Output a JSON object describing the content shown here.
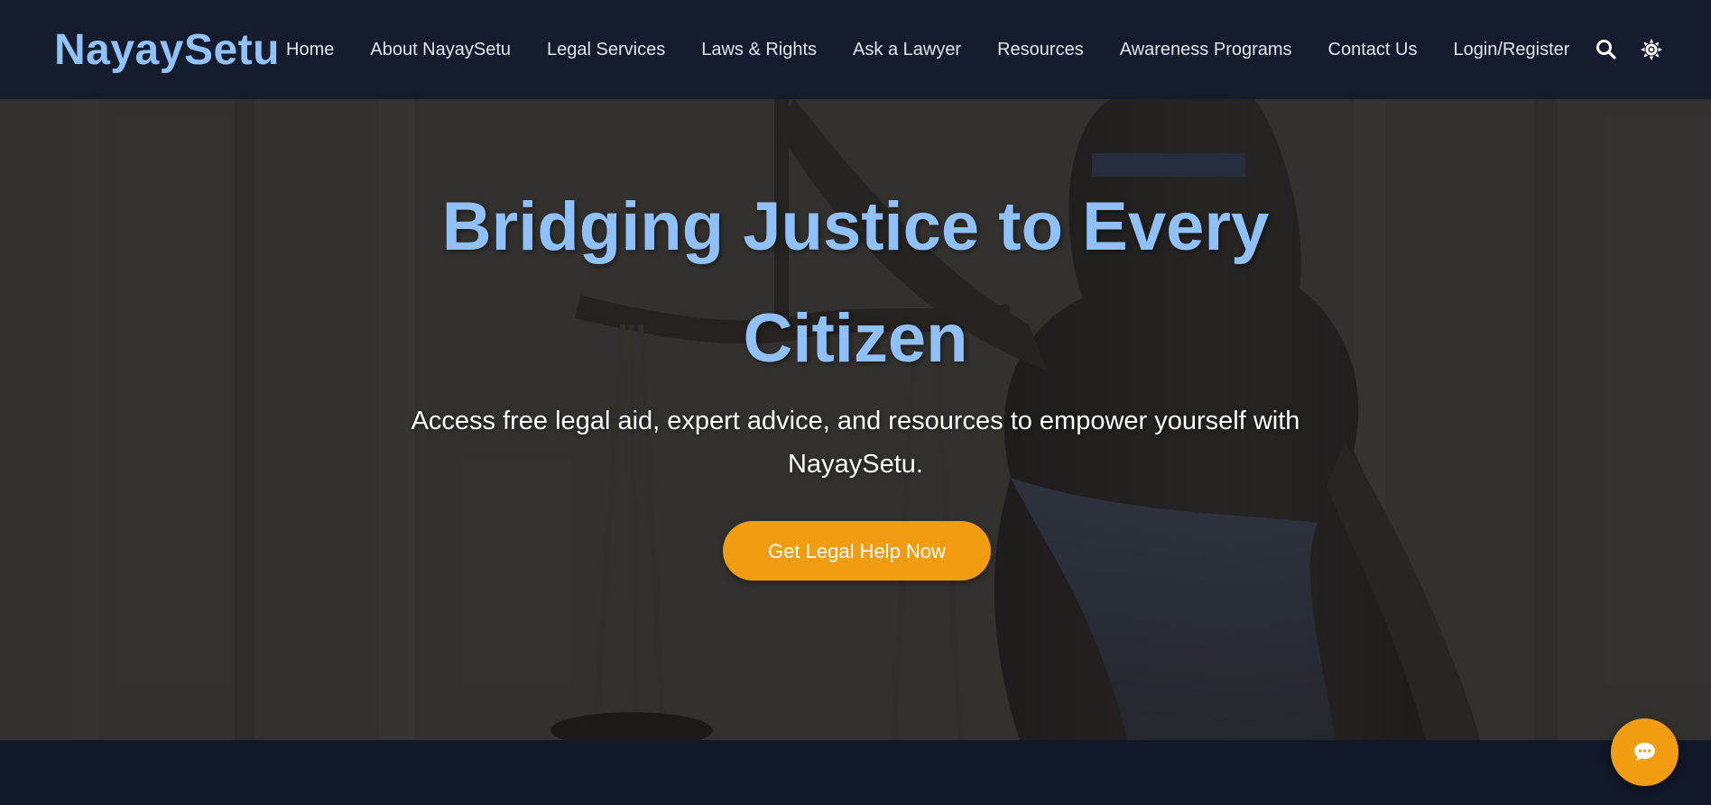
{
  "brand": {
    "logo_text": "NayaySetu",
    "logo_color": "#90c1f9"
  },
  "nav": {
    "items": [
      {
        "label": "Home"
      },
      {
        "label": "About NayaySetu"
      },
      {
        "label": "Legal Services"
      },
      {
        "label": "Laws & Rights"
      },
      {
        "label": "Ask a Lawyer"
      },
      {
        "label": "Resources"
      },
      {
        "label": "Awareness Programs"
      },
      {
        "label": "Contact Us"
      },
      {
        "label": "Login/Register"
      }
    ],
    "icons": [
      "search-icon",
      "theme-toggle-icon"
    ]
  },
  "hero": {
    "title": "Bridging Justice to Every Citizen",
    "subtitle": "Access free legal aid, expert advice, and resources to empower yourself with NayaySetu.",
    "cta_label": "Get Legal Help Now",
    "background": "lady-justice-statue-image"
  },
  "chat": {
    "icon": "chat-bubble-icon"
  },
  "colors": {
    "navbar": "#151c2e",
    "page_background": "#111827",
    "accent": "#f29c12",
    "title": "#8fc0f8"
  }
}
